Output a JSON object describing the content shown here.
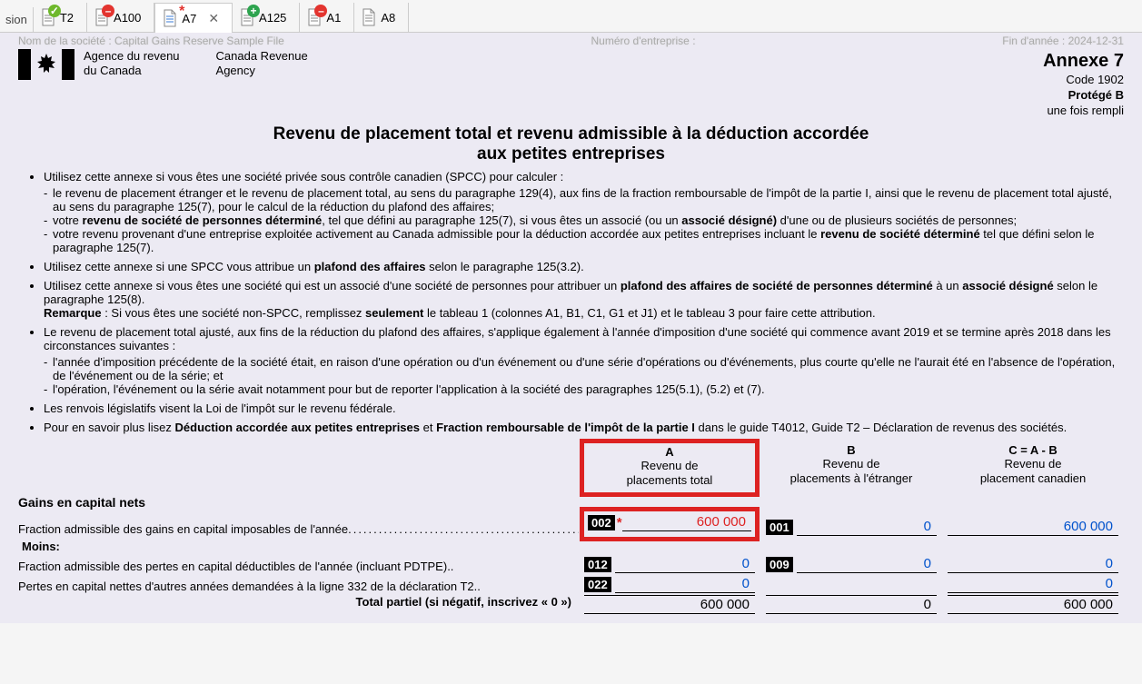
{
  "tabs": {
    "left_trunc": "sion",
    "items": [
      {
        "label": "T2",
        "badge": "green"
      },
      {
        "label": "A100",
        "badge": "red"
      },
      {
        "label": "A7",
        "badge": "star",
        "active": true
      },
      {
        "label": "A125",
        "badge": "plus"
      },
      {
        "label": "A1",
        "badge": "red"
      },
      {
        "label": "A8",
        "badge": "none"
      }
    ],
    "close_glyph": "✕"
  },
  "topmeta": {
    "left": "Nom de la société : Capital Gains Reserve Sample File",
    "mid": "Numéro d'entreprise :",
    "right": "Fin d'année : 2024-12-31"
  },
  "letterhead": {
    "agency_fr_1": "Agence du revenu",
    "agency_fr_2": "du Canada",
    "agency_en_1": "Canada Revenue",
    "agency_en_2": "Agency",
    "annexe": "Annexe 7",
    "code": "Code 1902",
    "prot": "Protégé B",
    "rempli": "une fois rempli"
  },
  "title_1": "Revenu de placement total et revenu admissible à la déduction accordée",
  "title_2": "aux petites entreprises",
  "bullets": {
    "b1": "Utilisez cette annexe si vous êtes une société privée sous contrôle canadien (SPCC) pour calculer :",
    "b1s1": "le revenu de placement étranger et le revenu de placement total, au sens du paragraphe 129(4), aux fins de la fraction remboursable de l'impôt de la partie I, ainsi que le revenu de placement total ajusté, au sens du paragraphe 125(7), pour le calcul de la réduction du plafond des affaires;",
    "b1s2_pre": "votre ",
    "b1s2_bold1": "revenu de société de personnes déterminé",
    "b1s2_mid": ", tel que défini au paragraphe 125(7), si vous êtes un associé (ou un ",
    "b1s2_bold2": "associé désigné)",
    "b1s2_post": " d'une ou de plusieurs sociétés de personnes;",
    "b1s3_pre": "votre revenu provenant d'une entreprise exploitée activement au Canada admissible pour la déduction accordée aux petites entreprises incluant le ",
    "b1s3_bold": "revenu de société déterminé",
    "b1s3_post": " tel que défini selon le paragraphe 125(7).",
    "b2_pre": "Utilisez cette annexe si une SPCC vous attribue un ",
    "b2_bold": "plafond des affaires",
    "b2_post": " selon le paragraphe 125(3.2).",
    "b3_pre": "Utilisez cette annexe si vous êtes une société qui est un associé d'une société de personnes pour attribuer un ",
    "b3_bold1": "plafond des affaires de société de personnes déterminé",
    "b3_mid": " à un ",
    "b3_bold2": "associé désigné",
    "b3_post": " selon le paragraphe 125(8).",
    "b3_rem_label": "Remarque",
    "b3_rem_pre": " : Si vous êtes une société non-SPCC, remplissez ",
    "b3_rem_bold": "seulement",
    "b3_rem_post": " le tableau 1 (colonnes A1, B1, C1, G1 et J1) et le tableau 3 pour faire cette attribution.",
    "b4": "Le revenu de placement total ajusté, aux fins de la réduction du plafond des affaires, s'applique également à l'année d'imposition d'une société qui commence avant 2019 et se termine après 2018 dans les circonstances suivantes :",
    "b4s1": "l'année d'imposition précédente de la société était, en raison d'une opération ou d'un événement ou d'une série d'opérations ou d'événements, plus courte qu'elle ne l'aurait été en l'absence de l'opération, de l'événement ou de la série; et",
    "b4s2": "l'opération, l'événement ou la série avait notamment pour but de reporter l'application à la société des paragraphes 125(5.1), (5.2) et (7).",
    "b5": "Les renvois législatifs visent la Loi de l'impôt sur le revenu fédérale.",
    "b6_pre": "Pour en savoir plus lisez ",
    "b6_bold1": "Déduction accordée aux petites entreprises",
    "b6_mid": " et ",
    "b6_bold2": "Fraction remboursable de l'impôt de la partie I",
    "b6_post": " dans le guide T4012, Guide T2 – Déclaration de revenus des sociétés."
  },
  "table": {
    "colA_h1": "A",
    "colA_h2": "Revenu de",
    "colA_h3": "placements total",
    "colB_h1": "B",
    "colB_h2": "Revenu de",
    "colB_h3": "placements à l'étranger",
    "colC_h1": "C = A - B",
    "colC_h2": "Revenu de",
    "colC_h3": "placement canadien",
    "section": "Gains en capital nets",
    "row1_label": "Fraction admissible des gains en capital imposables de l'année",
    "row1_codeA": "002",
    "row1_valA": "600 000",
    "row1_codeB": "001",
    "row1_valB": "0",
    "row1_valC": "600 000",
    "moins": "Moins:",
    "row2_label": "Fraction admissible des pertes en capital déductibles de l'année (incluant PDTPE)",
    "row2_codeA": "012",
    "row2_valA": "0",
    "row2_codeB": "009",
    "row2_valB": "0",
    "row2_valC": "0",
    "row3_label": "Pertes en capital nettes d'autres années demandées à la ligne 332 de la déclaration T2",
    "row3_codeA": "022",
    "row3_valA": "0",
    "row3_valC": "0",
    "subtotal_label": "Total partiel (si négatif, inscrivez « 0 »)",
    "subtotal_A": "600 000",
    "subtotal_B": "0",
    "subtotal_C": "600 000"
  }
}
